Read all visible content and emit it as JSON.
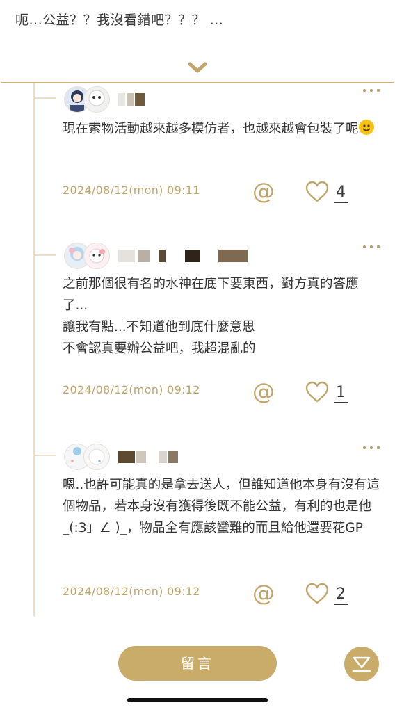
{
  "post": {
    "excerpt": "呃...公益？？我沒看錯吧？？？ ..."
  },
  "colors": {
    "accent": "#c9ab6a",
    "meta": "#c0a46a",
    "line": "#eadfc6"
  },
  "comments": [
    {
      "text": "現在索物活動越來越多模仿者，也越來越會包裝了呢",
      "emoji": "smiling-face",
      "timestamp": "2024/08/12(mon) 09:11",
      "likes": "4"
    },
    {
      "text": "之前那個很有名的水神在底下要東西，對方真的答應了...\n讓我有點...不知道他到底什麼意思\n不會認真要辦公益吧，我超混亂的",
      "timestamp": "2024/08/12(mon) 09:12",
      "likes": "1"
    },
    {
      "text": "嗯..也許可能真的是拿去送人，但誰知道他本身有沒有這個物品，若本身沒有獲得後既不能公益，有利的也是他_(:3」∠ )_，物品全有應該蠻難的而且給他還要花GP",
      "timestamp": "2024/08/12(mon) 09:12",
      "likes": "2"
    }
  ],
  "footer": {
    "reply_label": "留言"
  }
}
